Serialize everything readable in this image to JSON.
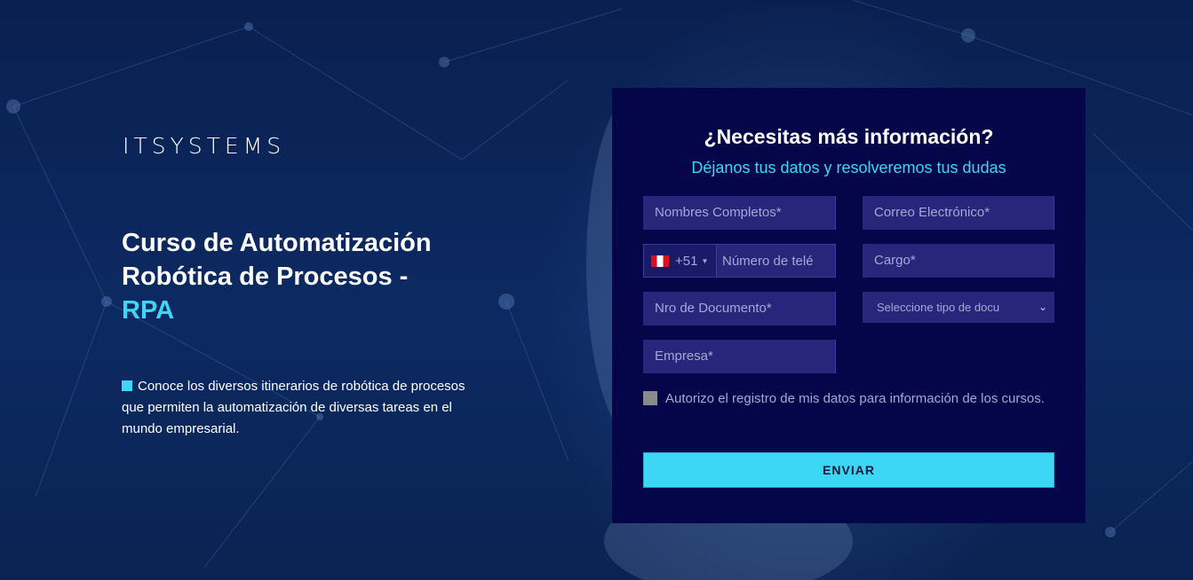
{
  "brand": {
    "logo_text": "ITSYSTEMS"
  },
  "hero": {
    "title": "Curso de Automatización Robótica de Procesos -",
    "title_accent": "RPA",
    "description": "Conoce los diversos itinerarios de robótica de procesos que permiten la automatización de diversas tareas en el mundo empresarial."
  },
  "form": {
    "title": "¿Necesitas más información?",
    "subtitle": "Déjanos tus datos y resolveremos tus dudas",
    "fields": {
      "full_name_placeholder": "Nombres Completos*",
      "email_placeholder": "Correo Electrónico*",
      "phone_country_code": "+51",
      "phone_placeholder": "Número de telé",
      "position_placeholder": "Cargo*",
      "document_number_placeholder": "Nro de Documento*",
      "document_type_selected": "Seleccione tipo de docu",
      "company_placeholder": "Empresa*"
    },
    "consent_text": "Autorizo el registro de mis datos para información de los cursos.",
    "submit_label": "ENVIAR"
  },
  "colors": {
    "accent": "#3dd7f5",
    "panel": "#05064a",
    "field_bg": "#26277a",
    "background": "#0b2356"
  },
  "icons": {
    "flag": "peru-flag-icon",
    "caret": "caret-down-icon",
    "select_chevron": "chevron-down-icon"
  }
}
